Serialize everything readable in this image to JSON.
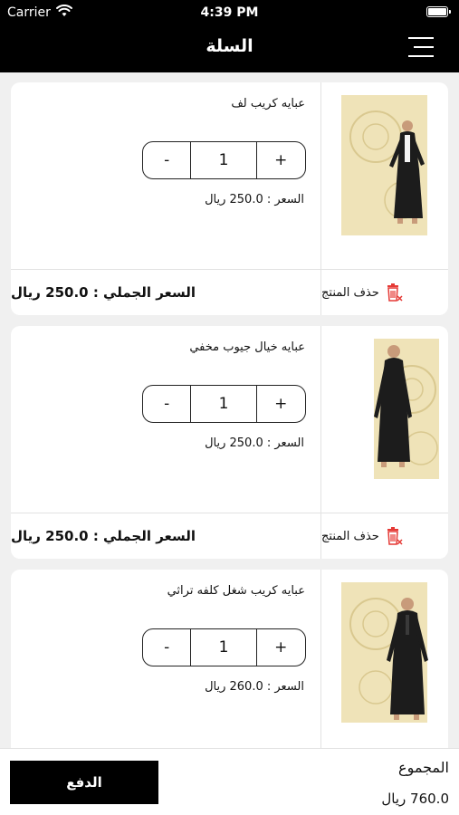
{
  "status_bar": {
    "carrier": "Carrier",
    "time": "4:39 PM"
  },
  "navbar": {
    "title": "السلة"
  },
  "cart": {
    "items": [
      {
        "name": "عبايه كريب لف",
        "quantity": "1",
        "minus": "-",
        "plus": "+",
        "price": "السعر : 250.0 ريال",
        "delete": "حذف المنتج",
        "total": "السعر الجملي : 250.0 ريال"
      },
      {
        "name": "عبايه خيال جيوب مخفي",
        "quantity": "1",
        "minus": "-",
        "plus": "+",
        "price": "السعر : 250.0 ريال",
        "delete": "حذف المنتج",
        "total": "السعر الجملي : 250.0 ريال"
      },
      {
        "name": "عبايه كريب شغل كلفه تراثي",
        "quantity": "1",
        "minus": "-",
        "plus": "+",
        "price": "السعر : 260.0 ريال",
        "delete": "",
        "total": ""
      }
    ]
  },
  "footer": {
    "pay_label": "الدفع",
    "sum_label": "المجموع",
    "sum_value": "760.0 ريال"
  },
  "colors": {
    "header_bg": "#000000",
    "delete_icon": "#e53935",
    "watermark": "#efe3b8"
  },
  "icons": [
    "wifi-icon",
    "battery-icon",
    "menu-icon",
    "trash-icon"
  ]
}
